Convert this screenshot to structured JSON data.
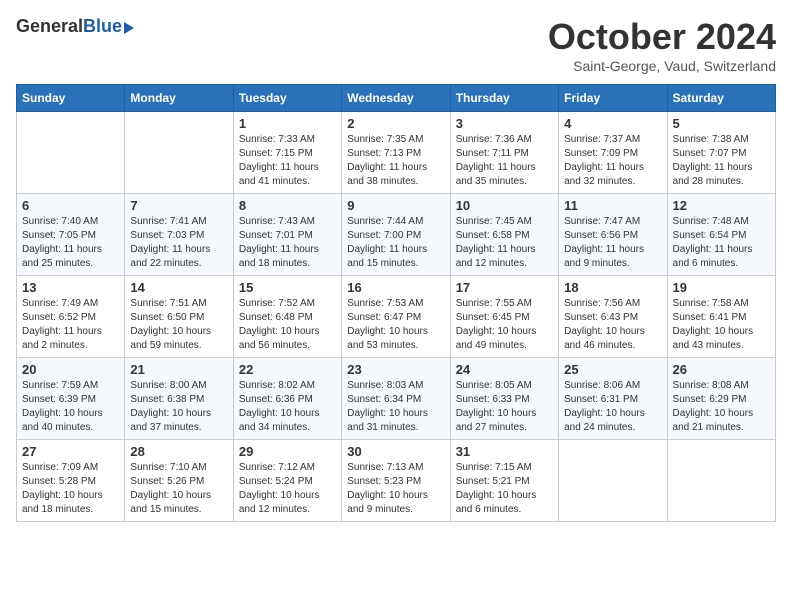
{
  "header": {
    "logo_general": "General",
    "logo_blue": "Blue",
    "month_title": "October 2024",
    "location": "Saint-George, Vaud, Switzerland"
  },
  "days_of_week": [
    "Sunday",
    "Monday",
    "Tuesday",
    "Wednesday",
    "Thursday",
    "Friday",
    "Saturday"
  ],
  "weeks": [
    [
      {
        "day": "",
        "sunrise": "",
        "sunset": "",
        "daylight": "",
        "empty": true
      },
      {
        "day": "",
        "sunrise": "",
        "sunset": "",
        "daylight": "",
        "empty": true
      },
      {
        "day": "1",
        "sunrise": "Sunrise: 7:33 AM",
        "sunset": "Sunset: 7:15 PM",
        "daylight": "Daylight: 11 hours and 41 minutes.",
        "empty": false
      },
      {
        "day": "2",
        "sunrise": "Sunrise: 7:35 AM",
        "sunset": "Sunset: 7:13 PM",
        "daylight": "Daylight: 11 hours and 38 minutes.",
        "empty": false
      },
      {
        "day": "3",
        "sunrise": "Sunrise: 7:36 AM",
        "sunset": "Sunset: 7:11 PM",
        "daylight": "Daylight: 11 hours and 35 minutes.",
        "empty": false
      },
      {
        "day": "4",
        "sunrise": "Sunrise: 7:37 AM",
        "sunset": "Sunset: 7:09 PM",
        "daylight": "Daylight: 11 hours and 32 minutes.",
        "empty": false
      },
      {
        "day": "5",
        "sunrise": "Sunrise: 7:38 AM",
        "sunset": "Sunset: 7:07 PM",
        "daylight": "Daylight: 11 hours and 28 minutes.",
        "empty": false
      }
    ],
    [
      {
        "day": "6",
        "sunrise": "Sunrise: 7:40 AM",
        "sunset": "Sunset: 7:05 PM",
        "daylight": "Daylight: 11 hours and 25 minutes.",
        "empty": false
      },
      {
        "day": "7",
        "sunrise": "Sunrise: 7:41 AM",
        "sunset": "Sunset: 7:03 PM",
        "daylight": "Daylight: 11 hours and 22 minutes.",
        "empty": false
      },
      {
        "day": "8",
        "sunrise": "Sunrise: 7:43 AM",
        "sunset": "Sunset: 7:01 PM",
        "daylight": "Daylight: 11 hours and 18 minutes.",
        "empty": false
      },
      {
        "day": "9",
        "sunrise": "Sunrise: 7:44 AM",
        "sunset": "Sunset: 7:00 PM",
        "daylight": "Daylight: 11 hours and 15 minutes.",
        "empty": false
      },
      {
        "day": "10",
        "sunrise": "Sunrise: 7:45 AM",
        "sunset": "Sunset: 6:58 PM",
        "daylight": "Daylight: 11 hours and 12 minutes.",
        "empty": false
      },
      {
        "day": "11",
        "sunrise": "Sunrise: 7:47 AM",
        "sunset": "Sunset: 6:56 PM",
        "daylight": "Daylight: 11 hours and 9 minutes.",
        "empty": false
      },
      {
        "day": "12",
        "sunrise": "Sunrise: 7:48 AM",
        "sunset": "Sunset: 6:54 PM",
        "daylight": "Daylight: 11 hours and 6 minutes.",
        "empty": false
      }
    ],
    [
      {
        "day": "13",
        "sunrise": "Sunrise: 7:49 AM",
        "sunset": "Sunset: 6:52 PM",
        "daylight": "Daylight: 11 hours and 2 minutes.",
        "empty": false
      },
      {
        "day": "14",
        "sunrise": "Sunrise: 7:51 AM",
        "sunset": "Sunset: 6:50 PM",
        "daylight": "Daylight: 10 hours and 59 minutes.",
        "empty": false
      },
      {
        "day": "15",
        "sunrise": "Sunrise: 7:52 AM",
        "sunset": "Sunset: 6:48 PM",
        "daylight": "Daylight: 10 hours and 56 minutes.",
        "empty": false
      },
      {
        "day": "16",
        "sunrise": "Sunrise: 7:53 AM",
        "sunset": "Sunset: 6:47 PM",
        "daylight": "Daylight: 10 hours and 53 minutes.",
        "empty": false
      },
      {
        "day": "17",
        "sunrise": "Sunrise: 7:55 AM",
        "sunset": "Sunset: 6:45 PM",
        "daylight": "Daylight: 10 hours and 49 minutes.",
        "empty": false
      },
      {
        "day": "18",
        "sunrise": "Sunrise: 7:56 AM",
        "sunset": "Sunset: 6:43 PM",
        "daylight": "Daylight: 10 hours and 46 minutes.",
        "empty": false
      },
      {
        "day": "19",
        "sunrise": "Sunrise: 7:58 AM",
        "sunset": "Sunset: 6:41 PM",
        "daylight": "Daylight: 10 hours and 43 minutes.",
        "empty": false
      }
    ],
    [
      {
        "day": "20",
        "sunrise": "Sunrise: 7:59 AM",
        "sunset": "Sunset: 6:39 PM",
        "daylight": "Daylight: 10 hours and 40 minutes.",
        "empty": false
      },
      {
        "day": "21",
        "sunrise": "Sunrise: 8:00 AM",
        "sunset": "Sunset: 6:38 PM",
        "daylight": "Daylight: 10 hours and 37 minutes.",
        "empty": false
      },
      {
        "day": "22",
        "sunrise": "Sunrise: 8:02 AM",
        "sunset": "Sunset: 6:36 PM",
        "daylight": "Daylight: 10 hours and 34 minutes.",
        "empty": false
      },
      {
        "day": "23",
        "sunrise": "Sunrise: 8:03 AM",
        "sunset": "Sunset: 6:34 PM",
        "daylight": "Daylight: 10 hours and 31 minutes.",
        "empty": false
      },
      {
        "day": "24",
        "sunrise": "Sunrise: 8:05 AM",
        "sunset": "Sunset: 6:33 PM",
        "daylight": "Daylight: 10 hours and 27 minutes.",
        "empty": false
      },
      {
        "day": "25",
        "sunrise": "Sunrise: 8:06 AM",
        "sunset": "Sunset: 6:31 PM",
        "daylight": "Daylight: 10 hours and 24 minutes.",
        "empty": false
      },
      {
        "day": "26",
        "sunrise": "Sunrise: 8:08 AM",
        "sunset": "Sunset: 6:29 PM",
        "daylight": "Daylight: 10 hours and 21 minutes.",
        "empty": false
      }
    ],
    [
      {
        "day": "27",
        "sunrise": "Sunrise: 7:09 AM",
        "sunset": "Sunset: 5:28 PM",
        "daylight": "Daylight: 10 hours and 18 minutes.",
        "empty": false
      },
      {
        "day": "28",
        "sunrise": "Sunrise: 7:10 AM",
        "sunset": "Sunset: 5:26 PM",
        "daylight": "Daylight: 10 hours and 15 minutes.",
        "empty": false
      },
      {
        "day": "29",
        "sunrise": "Sunrise: 7:12 AM",
        "sunset": "Sunset: 5:24 PM",
        "daylight": "Daylight: 10 hours and 12 minutes.",
        "empty": false
      },
      {
        "day": "30",
        "sunrise": "Sunrise: 7:13 AM",
        "sunset": "Sunset: 5:23 PM",
        "daylight": "Daylight: 10 hours and 9 minutes.",
        "empty": false
      },
      {
        "day": "31",
        "sunrise": "Sunrise: 7:15 AM",
        "sunset": "Sunset: 5:21 PM",
        "daylight": "Daylight: 10 hours and 6 minutes.",
        "empty": false
      },
      {
        "day": "",
        "sunrise": "",
        "sunset": "",
        "daylight": "",
        "empty": true
      },
      {
        "day": "",
        "sunrise": "",
        "sunset": "",
        "daylight": "",
        "empty": true
      }
    ]
  ]
}
